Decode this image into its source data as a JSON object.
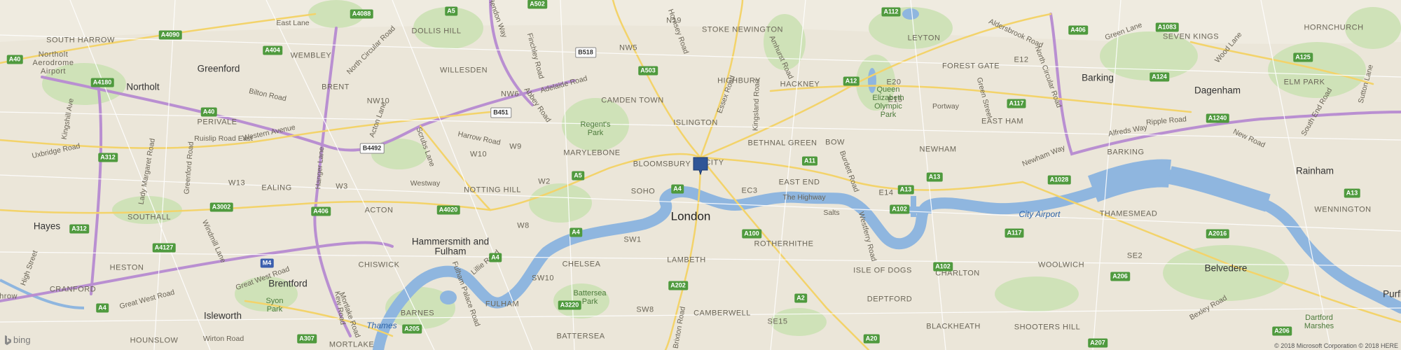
{
  "map": {
    "pin_icon": "location-marker",
    "brand": "bing",
    "brand_icon": "bing-logo",
    "copyright": "© 2018 Microsoft Corporation © 2018 HERE",
    "water_color": "#8fb6df",
    "park_color": "#cde1b6"
  },
  "labels": {
    "east_lane": "East Lane",
    "north_circular_road": "North Circular Road",
    "hendon_way": "Hendon Way",
    "dollis_hill": "DOLLIS HILL",
    "south_harrow": "SOUTH HARROW",
    "northolt": "Northolt",
    "greenford": "Greenford",
    "wembley": "WEMBLEY",
    "brent": "BRENT",
    "willesden": "WILLESDEN",
    "nw10": "NW10",
    "nw6": "NW6",
    "nw5": "NW5",
    "n19": "N19",
    "stoke_newington": "STOKE NEWINGTON",
    "highbury": "HIGHBURY",
    "hornsey_road": "Hornsey Road",
    "amhurst_road": "Amhurst Road",
    "essex_road": "Essex Road",
    "kingsland_road": "Kingsland Road",
    "hackney": "HACKNEY",
    "leyton": "LEYTON",
    "forest_gate": "FOREST GATE",
    "e20": "E20",
    "e12": "E12",
    "e15": "E15",
    "aldersbrook_road": "Aldersbrook Road",
    "seven_kings": "SEVEN KINGS",
    "green_lane": "Green Lane",
    "north_circular_road_east": "North Circular Road",
    "wood_lane": "Wood Lane",
    "hornchurch": "HORNCHURCH",
    "dagenham": "Dagenham",
    "elm_park": "ELM PARK",
    "barking": "Barking",
    "east_ham": "EAST HAM",
    "green_street": "Green Street",
    "portway": "Portway",
    "queen_elizabeth_olympic_park": "Queen Elizabeth Olympic Park",
    "alfreds_way": "Alfreds Way",
    "ripple_road": "Ripple Road",
    "new_road": "New Road",
    "rainham": "Rainham",
    "newham": "NEWHAM",
    "newham_way": "Newham Way",
    "barking_south": "BARKING",
    "wennington": "WENNINGTON",
    "south_end_road": "South End Road",
    "sutton_lane": "Sutton Lane",
    "camden_town": "CAMDEN TOWN",
    "islington": "ISLINGTON",
    "adelaide_road": "Adelaide Road",
    "abbey_road": "Abbey Road",
    "finchley_road": "Finchley Road",
    "regents_park": "Regent's Park",
    "marylebone": "MARYLEBONE",
    "bloomsbury": "BLOOMSBURY",
    "city": "CITY",
    "bethnal_green": "BETHNAL GREEN",
    "bow": "BOW",
    "burdett_road": "Burdett Road",
    "east_end": "EAST END",
    "ec3": "EC3",
    "the_highway": "The Highway",
    "e14": "E14",
    "salts": "Salts",
    "westferry_road": "Westferry Road",
    "city_airport": "City Airport",
    "thamesmead": "THAMESMEAD",
    "se2": "SE2",
    "belvedere": "Belvedere",
    "bexley_road": "Bexley Road",
    "dartford_marshes": "Dartford Marshes",
    "purfl": "Purfl",
    "woolwich": "WOOLWICH",
    "charlton": "CHARLTON",
    "shooters_hill": "SHOOTERS HILL",
    "blackheath": "BLACKHEATH",
    "deptford": "DEPTFORD",
    "isle_of_dogs": "ISLE OF DOGS",
    "rotherhithe": "ROTHERHITHE",
    "se15": "SE15",
    "camberwell": "CAMBERWELL",
    "lambeth": "LAMBETH",
    "london": "London",
    "soho": "SOHO",
    "sw1": "SW1",
    "chelsea": "CHELSEA",
    "battersea_park": "Battersea Park",
    "battersea": "BATTERSEA",
    "sw8": "SW8",
    "brixton_road": "Brixton Road",
    "mortlake": "MORTLAKE",
    "fulham": "FULHAM",
    "barnes": "BARNES",
    "thames": "Thames",
    "fulham_palace_road": "Fulham Palace Road",
    "lillie_road": "Lillie Road",
    "sw10": "SW10",
    "hammersmith_and_fulham": "Hammersmith and Fulham",
    "chiswick": "CHISWICK",
    "brentford": "Brentford",
    "syon_park": "Syon Park",
    "kew_road": "Kew Road",
    "mortlake_road": "Mortlake Road",
    "isleworth": "Isleworth",
    "hounslow": "HOUNSLOW",
    "wirton_road": "Wirton Road",
    "great_west_road": "Great West Road",
    "great_west_road_2": "Great West Road",
    "heston": "HESTON",
    "cranford": "CRANFORD",
    "high_street": "High Street",
    "hayes": "Hayes",
    "southall": "SOUTHALL",
    "windmill_lane": "Windmill Lane",
    "ealing": "EALING",
    "w13": "W13",
    "w3": "W3",
    "acton": "ACTON",
    "westway": "Westway",
    "notting_hill": "NOTTING HILL",
    "w2": "W2",
    "w8": "W8",
    "w9": "W9",
    "w10": "W10",
    "harrow_road": "Harrow Road",
    "scrubs_lane": "Scrubs Lane",
    "acton_lane": "Acton Lane",
    "hanger_lane": "Hanger Lane",
    "western_avenue": "Western Avenue",
    "perivale": "PERIVALE",
    "bilton_road": "Bilton Road",
    "ruislip_road_east": "Ruislip Road East",
    "uxbridge_road": "Uxbridge Road",
    "lady_margaret_road": "Lady Margaret Road",
    "greenford_road": "Greenford Road",
    "kingshill_avenue": "Kingshill Ave",
    "northolt_aerodrome_airport": "Northolt Aerodrome Airport",
    "london_heathrow": "hrow"
  },
  "shields": {
    "a4088": "A4088",
    "a5": "A5",
    "a502": "A502",
    "a4090": "A4090",
    "a40": "A40",
    "a404": "A404",
    "a4180": "A4180",
    "a40b": "A40",
    "a312": "A312",
    "a4127": "A4127",
    "a312b": "A312",
    "a3002": "A3002",
    "a406": "A406",
    "m4": "M4",
    "a4": "A4",
    "a4b": "A4",
    "a205": "A205",
    "a307": "A307",
    "a4020": "A4020",
    "b4492": "B4492",
    "b518": "B518",
    "a503": "A503",
    "b451": "B451",
    "a5b": "A5",
    "a4c": "A4",
    "a3220": "A3220",
    "a4d": "A4",
    "a202": "A202",
    "a100": "A100",
    "a2": "A2",
    "a20": "A20",
    "a11": "A11",
    "a13": "A13",
    "a102": "A102",
    "a13b": "A13",
    "a102b": "A102",
    "a117": "A117",
    "a1028": "A1028",
    "a206": "A206",
    "a207": "A207",
    "a2016": "A2016",
    "a206b": "A206",
    "a13c": "A13",
    "a112": "A112",
    "a12": "A12",
    "a406b": "A406",
    "a1083": "A1083",
    "a124": "A124",
    "a1240": "A1240",
    "a125": "A125",
    "a117b": "A117"
  }
}
